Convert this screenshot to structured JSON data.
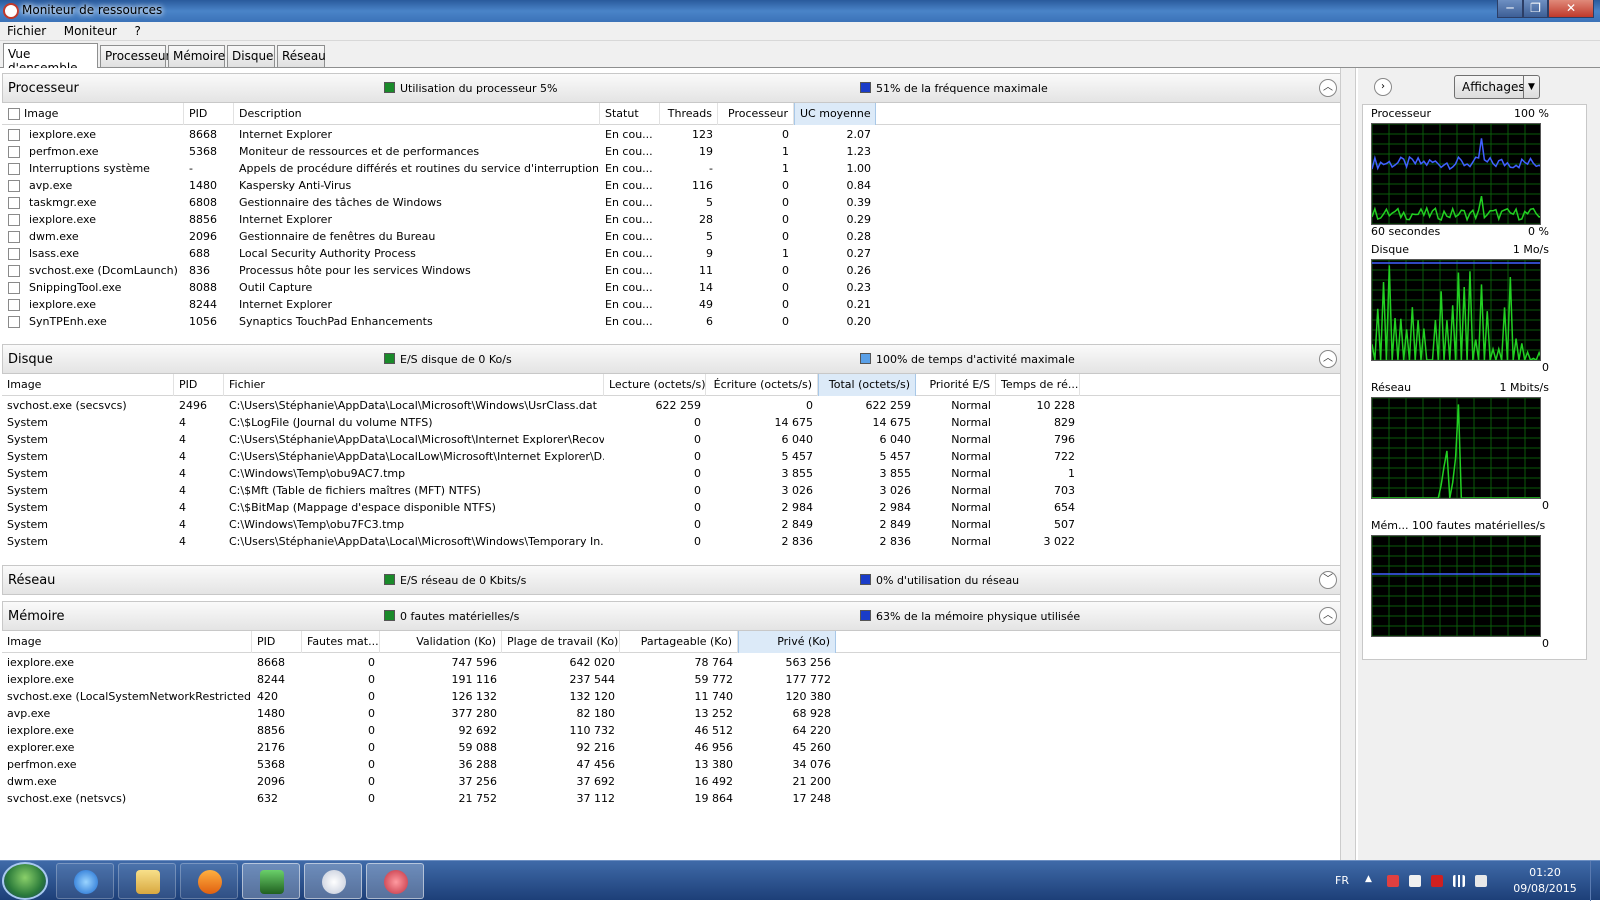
{
  "window": {
    "title": "Moniteur de ressources",
    "controls": [
      "─",
      "❐",
      "✕"
    ]
  },
  "menu": [
    "Fichier",
    "Moniteur",
    "?"
  ],
  "tabs": [
    "Vue d'ensemble",
    "Processeur",
    "Mémoire",
    "Disque",
    "Réseau"
  ],
  "active_tab": "Vue d'ensemble",
  "colors": {
    "green": "#1a8a2a",
    "blue": "#1a3cc8",
    "graph_green": "#22d022",
    "graph_blue": "#4060ff"
  },
  "cpu": {
    "name": "Processeur",
    "stat1": "Utilisation du processeur 5%",
    "stat2": "51% de la fréquence maximale",
    "columns": [
      "Image",
      "PID",
      "Description",
      "Statut",
      "Threads",
      "Processeur",
      "UC moyenne"
    ],
    "rows": [
      [
        "iexplore.exe",
        "8668",
        "Internet Explorer",
        "En cou...",
        "123",
        "0",
        "2.07"
      ],
      [
        "perfmon.exe",
        "5368",
        "Moniteur de ressources et de performances",
        "En cou...",
        "19",
        "1",
        "1.23"
      ],
      [
        "Interruptions système",
        "-",
        "Appels de procédure différés et routines du service d'interruption",
        "En cou...",
        "-",
        "1",
        "1.00"
      ],
      [
        "avp.exe",
        "1480",
        "Kaspersky Anti-Virus",
        "En cou...",
        "116",
        "0",
        "0.84"
      ],
      [
        "taskmgr.exe",
        "6808",
        "Gestionnaire des tâches de Windows",
        "En cou...",
        "5",
        "0",
        "0.39"
      ],
      [
        "iexplore.exe",
        "8856",
        "Internet Explorer",
        "En cou...",
        "28",
        "0",
        "0.29"
      ],
      [
        "dwm.exe",
        "2096",
        "Gestionnaire de fenêtres du Bureau",
        "En cou...",
        "5",
        "0",
        "0.28"
      ],
      [
        "lsass.exe",
        "688",
        "Local Security Authority Process",
        "En cou...",
        "9",
        "1",
        "0.27"
      ],
      [
        "svchost.exe (DcomLaunch)",
        "836",
        "Processus hôte pour les services Windows",
        "En cou...",
        "11",
        "0",
        "0.26"
      ],
      [
        "SnippingTool.exe",
        "8088",
        "Outil Capture",
        "En cou...",
        "14",
        "0",
        "0.23"
      ],
      [
        "iexplore.exe",
        "8244",
        "Internet Explorer",
        "En cou...",
        "49",
        "0",
        "0.21"
      ],
      [
        "SynTPEnh.exe",
        "1056",
        "Synaptics TouchPad Enhancements",
        "En cou...",
        "6",
        "0",
        "0.20"
      ]
    ]
  },
  "disk": {
    "name": "Disque",
    "stat1": "E/S disque de 0 Ko/s",
    "stat2": "100% de temps d'activité maximale",
    "columns": [
      "Image",
      "PID",
      "Fichier",
      "Lecture (octets/s)",
      "Écriture (octets/s)",
      "Total (octets/s)",
      "Priorité E/S",
      "Temps de ré..."
    ],
    "rows": [
      [
        "svchost.exe (secsvcs)",
        "2496",
        "C:\\Users\\Stéphanie\\AppData\\Local\\Microsoft\\Windows\\UsrClass.dat",
        "622 259",
        "0",
        "622 259",
        "Normal",
        "10 228"
      ],
      [
        "System",
        "4",
        "C:\\$LogFile (Journal du volume NTFS)",
        "0",
        "14 675",
        "14 675",
        "Normal",
        "829"
      ],
      [
        "System",
        "4",
        "C:\\Users\\Stéphanie\\AppData\\Local\\Microsoft\\Internet Explorer\\Recov...",
        "0",
        "6 040",
        "6 040",
        "Normal",
        "796"
      ],
      [
        "System",
        "4",
        "C:\\Users\\Stéphanie\\AppData\\LocalLow\\Microsoft\\Internet Explorer\\D...",
        "0",
        "5 457",
        "5 457",
        "Normal",
        "722"
      ],
      [
        "System",
        "4",
        "C:\\Windows\\Temp\\obu9AC7.tmp",
        "0",
        "3 855",
        "3 855",
        "Normal",
        "1"
      ],
      [
        "System",
        "4",
        "C:\\$Mft (Table de fichiers maîtres (MFT) NTFS)",
        "0",
        "3 026",
        "3 026",
        "Normal",
        "703"
      ],
      [
        "System",
        "4",
        "C:\\$BitMap (Mappage d'espace disponible NTFS)",
        "0",
        "2 984",
        "2 984",
        "Normal",
        "654"
      ],
      [
        "System",
        "4",
        "C:\\Windows\\Temp\\obu7FC3.tmp",
        "0",
        "2 849",
        "2 849",
        "Normal",
        "507"
      ],
      [
        "System",
        "4",
        "C:\\Users\\Stéphanie\\AppData\\Local\\Microsoft\\Windows\\Temporary In...",
        "0",
        "2 836",
        "2 836",
        "Normal",
        "3 022"
      ]
    ]
  },
  "network": {
    "name": "Réseau",
    "stat1": "E/S réseau de 0 Kbits/s",
    "stat2": "0% d'utilisation du réseau"
  },
  "memory": {
    "name": "Mémoire",
    "stat1": "0 fautes matérielles/s",
    "stat2": "63% de la mémoire physique utilisée",
    "columns": [
      "Image",
      "PID",
      "Fautes mat...",
      "Validation (Ko)",
      "Plage de travail (Ko)",
      "Partageable (Ko)",
      "Privé (Ko)"
    ],
    "rows": [
      [
        "iexplore.exe",
        "8668",
        "0",
        "747 596",
        "642 020",
        "78 764",
        "563 256"
      ],
      [
        "iexplore.exe",
        "8244",
        "0",
        "191 116",
        "237 544",
        "59 772",
        "177 772"
      ],
      [
        "svchost.exe (LocalSystemNetworkRestricted)",
        "420",
        "0",
        "126 132",
        "132 120",
        "11 740",
        "120 380"
      ],
      [
        "avp.exe",
        "1480",
        "0",
        "377 280",
        "82 180",
        "13 252",
        "68 928"
      ],
      [
        "iexplore.exe",
        "8856",
        "0",
        "92 692",
        "110 732",
        "46 512",
        "64 220"
      ],
      [
        "explorer.exe",
        "2176",
        "0",
        "59 088",
        "92 216",
        "46 956",
        "45 260"
      ],
      [
        "perfmon.exe",
        "5368",
        "0",
        "36 288",
        "47 456",
        "13 380",
        "34 076"
      ],
      [
        "dwm.exe",
        "2096",
        "0",
        "37 256",
        "37 692",
        "16 492",
        "21 200"
      ],
      [
        "svchost.exe (netsvcs)",
        "632",
        "0",
        "21 752",
        "37 112",
        "19 864",
        "17 248"
      ]
    ]
  },
  "side": {
    "view_button": "Affichages",
    "graphs": [
      {
        "label": "Processeur",
        "max": "100 %",
        "bottom_left": "60 secondes",
        "bottom_right": "0 %"
      },
      {
        "label": "Disque",
        "max": "1 Mo/s",
        "bottom_left": "",
        "bottom_right": "0"
      },
      {
        "label": "Réseau",
        "max": "1 Mbits/s",
        "bottom_left": "",
        "bottom_right": "0"
      },
      {
        "label": "Mém... 100 fautes matérielles/s",
        "max": "",
        "bottom_left": "",
        "bottom_right": "0"
      }
    ]
  },
  "taskbar": {
    "lang": "FR",
    "time": "01:20",
    "date": "09/08/2015",
    "items": [
      "internet-explorer-icon",
      "folder-icon",
      "media-player-icon",
      "task-manager-icon",
      "resource-monitor-icon",
      "snipping-tool-icon"
    ]
  }
}
